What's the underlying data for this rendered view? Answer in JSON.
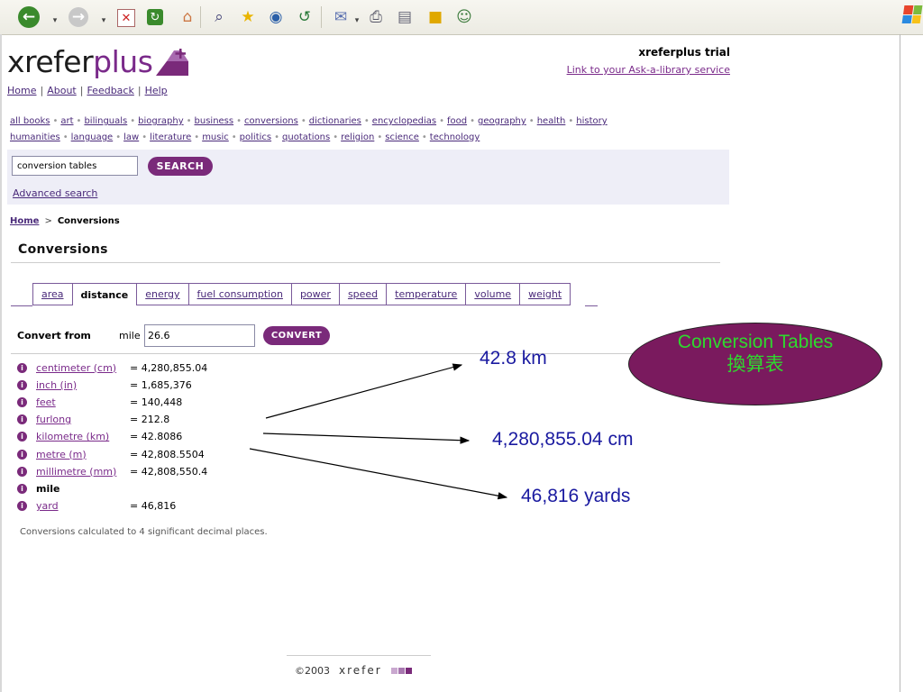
{
  "toolbar": {
    "buttons": [
      "back-icon",
      "forward-icon",
      "stop-icon",
      "refresh-icon",
      "home-icon",
      "search-icon",
      "favorites-icon",
      "media-icon",
      "history-icon",
      "mail-icon",
      "print-icon",
      "edit-icon",
      "discuss-icon",
      "messenger-icon"
    ]
  },
  "header": {
    "logo_part1": "xrefer",
    "logo_part2": "plus",
    "account": "xreferplus trial",
    "ask_library": "Link to your Ask-a-library service",
    "nav": [
      "Home",
      "About",
      "Feedback",
      "Help"
    ]
  },
  "categories": {
    "row1": [
      "all books",
      "art",
      "bilinguals",
      "biography",
      "business",
      "conversions",
      "dictionaries",
      "encyclopedias",
      "food",
      "geography",
      "health",
      "history"
    ],
    "row2": [
      "humanities",
      "language",
      "law",
      "literature",
      "music",
      "politics",
      "quotations",
      "religion",
      "science",
      "technology"
    ]
  },
  "search": {
    "value": "conversion tables",
    "button": "SEARCH",
    "advanced": "Advanced search"
  },
  "breadcrumb": {
    "home": "Home",
    "sep": ">",
    "current": "Conversions"
  },
  "page_title": "Conversions",
  "tabs": [
    "area",
    "distance",
    "energy",
    "fuel consumption",
    "power",
    "speed",
    "temperature",
    "volume",
    "weight"
  ],
  "active_tab": "distance",
  "convert": {
    "label": "Convert from",
    "unit": "mile",
    "value": "26.6",
    "button": "CONVERT"
  },
  "results": [
    {
      "unit": "centimeter (cm)",
      "value": "= 4,280,855.04"
    },
    {
      "unit": "inch (in)",
      "value": "= 1,685,376"
    },
    {
      "unit": "feet",
      "value": "= 140,448"
    },
    {
      "unit": "furlong",
      "value": "= 212.8"
    },
    {
      "unit": "kilometre (km)",
      "value": "= 42.8086"
    },
    {
      "unit": "metre (m)",
      "value": "= 42,808.5504"
    },
    {
      "unit": "millimetre (mm)",
      "value": "= 42,808,550.4"
    },
    {
      "unit": "mile",
      "value": ""
    },
    {
      "unit": "yard",
      "value": "= 46,816"
    }
  ],
  "footnote": "Conversions calculated to 4 significant decimal places.",
  "footer": {
    "copyright": "©2003",
    "brand": "xrefer"
  },
  "annotations": {
    "title_en": "Conversion Tables",
    "title_zh": "換算表",
    "note_km": "42.8 km",
    "note_cm": "4,280,855.04 cm",
    "note_yards": "46,816 yards"
  },
  "colors": {
    "brand_purple": "#7a2a7a",
    "annotation_fill": "#7a1a5e",
    "annotation_text": "#2ed92e",
    "note_text": "#1a1aa0"
  }
}
